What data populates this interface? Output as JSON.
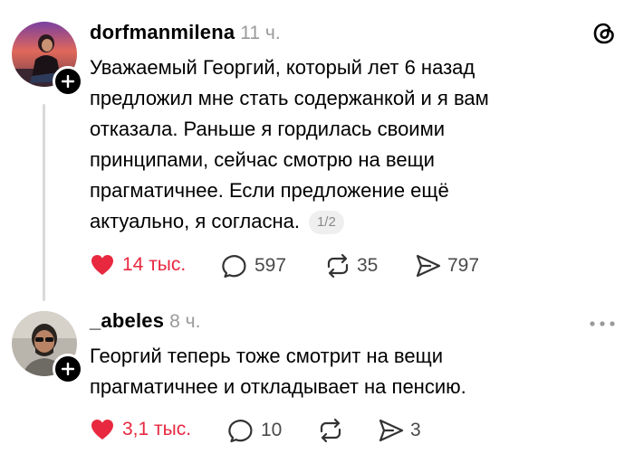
{
  "posts": [
    {
      "username": "dorfmanmilena",
      "time": "11 ч.",
      "text_lines": [
        "Уважаемый Георгий, который лет 6 назад",
        "предложил мне стать содержанкой и я вам",
        "отказала. Раньше я гордилась своими",
        "принципами, сейчас смотрю на вещи",
        "прагматичнее. Если предложение ещё",
        "актуально, я согласна."
      ],
      "page_indicator": "1/2",
      "likes": "14 тыс.",
      "comments": "597",
      "reposts": "35",
      "shares": "797"
    },
    {
      "username": "_abeles",
      "time": "8 ч.",
      "text_lines": [
        "Георгий теперь тоже смотрит на вещи",
        "прагматичнее и откладывает на пенсию."
      ],
      "likes": "3,1 тыс.",
      "comments": "10",
      "shares": "3"
    }
  ],
  "colors": {
    "like": "#e8283f",
    "muted": "#9a9a9a",
    "thread_line": "#d9d9d9"
  },
  "icons": [
    "threads-logo-icon",
    "heart-icon",
    "comment-icon",
    "repost-icon",
    "share-icon",
    "more-icon",
    "plus-icon"
  ]
}
